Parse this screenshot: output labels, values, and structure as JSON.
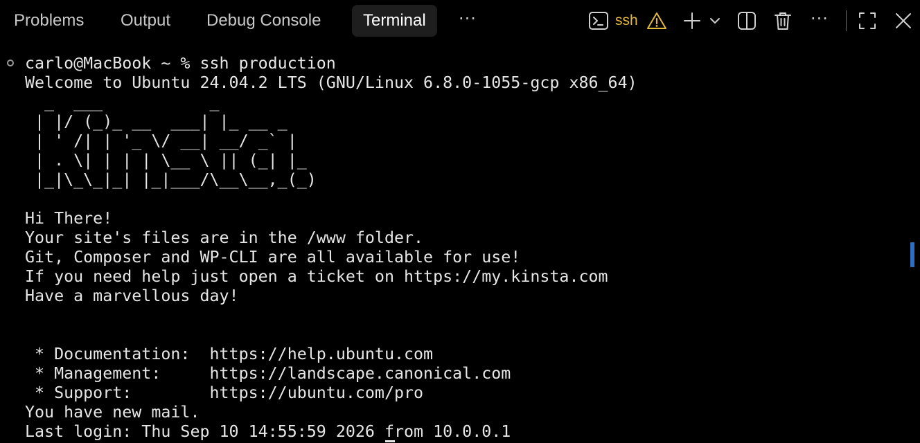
{
  "tabs": [
    {
      "label": "Problems",
      "active": false
    },
    {
      "label": "Output",
      "active": false
    },
    {
      "label": "Debug Console",
      "active": false
    },
    {
      "label": "Terminal",
      "active": true
    }
  ],
  "more_tabs_label": "···",
  "terminal_profile": {
    "name": "ssh",
    "icon": "terminal-icon",
    "warning_icon": "warning-icon",
    "color": "#e2b93b"
  },
  "toolbar_icons": [
    "plus-icon",
    "chevron-down-icon",
    "split-icon",
    "trash-icon",
    "ellipsis-icon",
    "maximize-icon",
    "close-icon"
  ],
  "more_actions_label": "···",
  "terminal": {
    "lines": [
      "carlo@MacBook ~ % ssh production",
      "Welcome to Ubuntu 24.04.2 LTS (GNU/Linux 6.8.0-1055-gcp x86_64)",
      "  _  ___           _",
      " | |/ (_)_ __  ___| |_ __ _",
      " | ' /| | '_ \\/ __| __/ _` |",
      " | . \\| | | | \\__ \\ || (_| |_",
      " |_|\\_\\_|_| |_|___/\\__\\__,_(_)",
      "",
      "Hi There!",
      "Your site's files are in the /www folder.",
      "Git, Composer and WP-CLI are all available for use!",
      "If you need help just open a ticket on https://my.kinsta.com",
      "Have a marvellous day!",
      "",
      "",
      " * Documentation:  https://help.ubuntu.com",
      " * Management:     https://landscape.canonical.com",
      " * Support:        https://ubuntu.com/pro",
      "You have new mail.",
      "Last login: Thu Sep 10 14:55:59 2026 from 10.0.0.1"
    ]
  },
  "colors": {
    "background": "#000000",
    "active_tab_bg": "#1e1e1e",
    "text": "#e6e6e6",
    "accent_warning": "#e2b93b",
    "scrollbar": "#2d6fbf"
  }
}
